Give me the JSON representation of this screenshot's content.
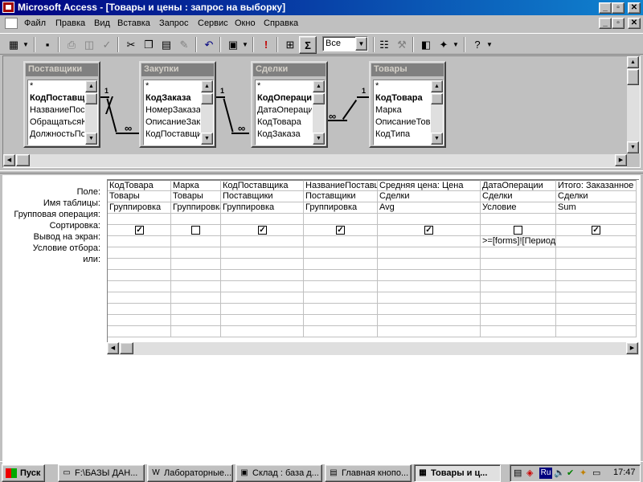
{
  "window": {
    "title": "Microsoft Access - [Товары и цены : запрос на выборку]"
  },
  "menu": [
    "Файл",
    "Правка",
    "Вид",
    "Вставка",
    "Запрос",
    "Сервис",
    "Окно",
    "Справка"
  ],
  "toolbar": {
    "combo_value": "Все",
    "sigma": "Σ"
  },
  "tables": [
    {
      "title": "Поставщики",
      "fields": [
        "*",
        "КодПоставщика",
        "НазваниеПоставщика",
        "ОбращатьсяК",
        "ДолжностьПолучателя"
      ]
    },
    {
      "title": "Закупки",
      "fields": [
        "*",
        "КодЗаказа",
        "НомерЗаказа",
        "ОписаниеЗаказа",
        "КодПоставщика"
      ]
    },
    {
      "title": "Сделки",
      "fields": [
        "*",
        "КодОперации",
        "ДатаОперации",
        "КодТовара",
        "КодЗаказа"
      ]
    },
    {
      "title": "Товары",
      "fields": [
        "*",
        "КодТовара",
        "Марка",
        "ОписаниеТовара",
        "КодТипа"
      ]
    }
  ],
  "relations": {
    "one": "1",
    "many": "∞"
  },
  "grid": {
    "row_labels": [
      "Поле:",
      "Имя таблицы:",
      "Групповая операция:",
      "Сортировка:",
      "Вывод на экран:",
      "Условие отбора:",
      "или:"
    ],
    "columns": [
      {
        "field": "КодТовара",
        "table": "Товары",
        "group": "Группировка",
        "sort": "",
        "show": true,
        "criteria": ""
      },
      {
        "field": "Марка",
        "table": "Товары",
        "group": "Группировка",
        "sort": "",
        "show": false,
        "criteria": ""
      },
      {
        "field": "КодПоставщика",
        "table": "Поставщики",
        "group": "Группировка",
        "sort": "",
        "show": true,
        "criteria": ""
      },
      {
        "field": "НазваниеПоставщика",
        "table": "Поставщики",
        "group": "Группировка",
        "sort": "",
        "show": true,
        "criteria": ""
      },
      {
        "field": "Средняя цена: Цена",
        "table": "Сделки",
        "group": "Avg",
        "sort": "",
        "show": true,
        "criteria": ""
      },
      {
        "field": "ДатаОперации",
        "table": "Сделки",
        "group": "Условие",
        "sort": "",
        "show": false,
        "criteria": ">=[forms]![Период]"
      },
      {
        "field": "Итого: Заказанное",
        "table": "Сделки",
        "group": "Sum",
        "sort": "",
        "show": true,
        "criteria": ""
      }
    ]
  },
  "taskbar": {
    "start": "Пуск",
    "tasks": [
      "F:\\БАЗЫ ДАН...",
      "Лабораторные...",
      "Склад : база д...",
      "Главная кнопо...",
      "Товары и ц..."
    ],
    "lang": "Ru",
    "clock": "17:47"
  }
}
